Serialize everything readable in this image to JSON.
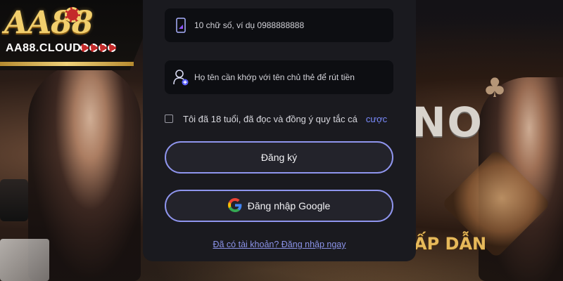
{
  "brand": {
    "logo_text": "AA88",
    "domain": "AA88.CLOUD"
  },
  "background": {
    "casino_text": "NO",
    "tagline_text": "ẤP DẪN"
  },
  "form": {
    "phone": {
      "placeholder": "10 chữ số, ví dụ 0988888888",
      "value": ""
    },
    "full_name": {
      "placeholder": "Họ tên cần khớp với tên chủ thẻ để rút tiền",
      "value": ""
    },
    "terms": {
      "checked": false,
      "label": "Tôi đã 18 tuổi, đã đọc và đồng ý quy tắc cá",
      "link_text": "cược"
    },
    "register_label": "Đăng ký",
    "google_label": "Đăng nhập Google",
    "login_prompt": "Đã có tài khoản? Đăng nhập ngay"
  },
  "colors": {
    "accent": "#8f95ee",
    "link": "#7b8cff",
    "panel": "#1a1a1f",
    "logo_gold": "#f2cf6d"
  },
  "icons": {
    "phone": "phone-icon",
    "user": "user-add-icon",
    "google": "google-icon",
    "club": "club-icon"
  }
}
